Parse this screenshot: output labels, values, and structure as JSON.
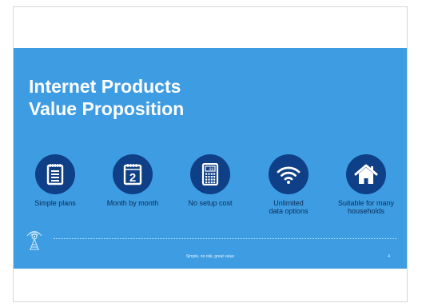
{
  "slide": {
    "title_line1": "Internet Products",
    "title_line2": "Value Proposition",
    "features": [
      {
        "label": "Simple plans",
        "icon": "notepad-icon"
      },
      {
        "label": "Month by month",
        "icon": "calendar-icon",
        "calendar_number": "2"
      },
      {
        "label": "No setup cost",
        "icon": "calculator-icon",
        "calculator_display": "00"
      },
      {
        "label": "Unlimited\ndata options",
        "icon": "wifi-icon"
      },
      {
        "label": "Suitable for many\nhouseholds",
        "icon": "house-icon"
      }
    ],
    "footer_text": "Simple, no risk, great value",
    "page_number": "4",
    "logo": "radio-tower-icon"
  },
  "colors": {
    "slide_background": "#3d9ce2",
    "icon_circle": "#0f3f86",
    "title": "#ffffff",
    "label": "#0d2c57"
  }
}
